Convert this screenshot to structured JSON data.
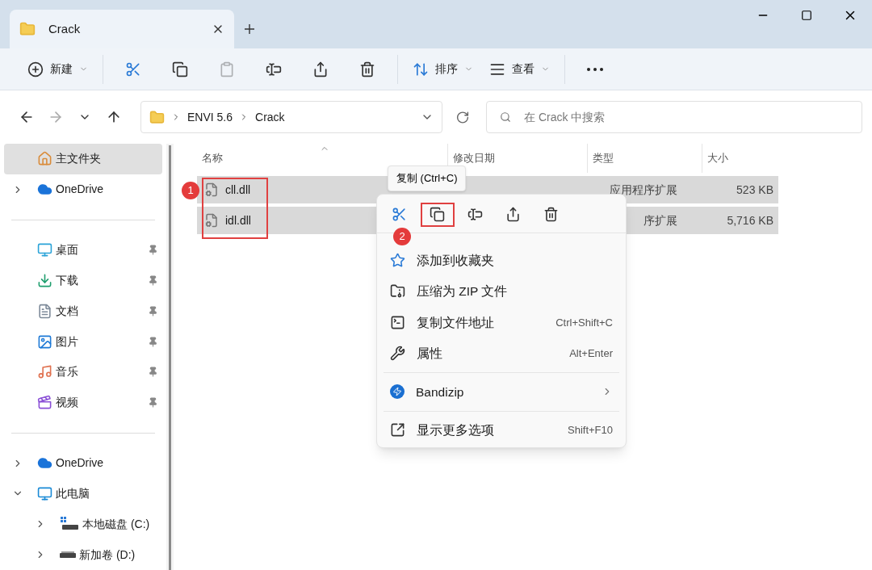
{
  "tabs": [
    {
      "label": "Crack",
      "selected": true
    }
  ],
  "toolbar": [
    {
      "kind": "new",
      "label": "新建",
      "disabled": false
    },
    {
      "kind": "cut",
      "disabled": false
    },
    {
      "kind": "copy",
      "disabled": false
    },
    {
      "kind": "paste",
      "disabled": true
    },
    {
      "kind": "rename",
      "disabled": false
    },
    {
      "kind": "share",
      "disabled": false
    },
    {
      "kind": "delete",
      "disabled": false
    },
    {
      "kind": "sort",
      "label": "排序",
      "disabled": false
    },
    {
      "kind": "view",
      "label": "查看",
      "disabled": false
    },
    {
      "kind": "more",
      "disabled": false
    }
  ],
  "breadcrumb": [
    "ENVI 5.6",
    "Crack"
  ],
  "search": {
    "placeholder": "在 Crack 中搜索"
  },
  "sidebar": {
    "sections": [
      [
        {
          "kind": "home",
          "label": "主文件夹",
          "selected": true
        },
        {
          "kind": "cloud",
          "label": "OneDrive",
          "selected": false,
          "expanded": false
        }
      ],
      [
        {
          "kind": "desktop",
          "label": "桌面",
          "selected": false,
          "pinned": true
        },
        {
          "kind": "download",
          "label": "下载",
          "selected": false,
          "pinned": true
        },
        {
          "kind": "docs",
          "label": "文档",
          "selected": false,
          "pinned": true
        },
        {
          "kind": "pictures",
          "label": "图片",
          "selected": false,
          "pinned": true
        },
        {
          "kind": "music",
          "label": "音乐",
          "selected": false,
          "pinned": true
        },
        {
          "kind": "video",
          "label": "视频",
          "selected": false,
          "pinned": true
        }
      ],
      [
        {
          "kind": "cloud",
          "label": "OneDrive",
          "selected": false,
          "expanded": false
        },
        {
          "kind": "pc",
          "label": "此电脑",
          "selected": false,
          "expanded": true,
          "children": [
            {
              "kind": "drive-c",
              "label": "本地磁盘 (C:)",
              "selected": false,
              "expanded": false
            },
            {
              "kind": "drive",
              "label": "新加卷 (D:)",
              "selected": false,
              "expanded": false
            }
          ]
        }
      ]
    ]
  },
  "table": {
    "columns": [
      "名称",
      "修改日期",
      "类型",
      "大小"
    ],
    "rows": [
      {
        "name": "cll.dll",
        "selected": true,
        "type": "应用程序扩展",
        "size": "523 KB"
      },
      {
        "name": "idl.dll",
        "selected": true,
        "type": "序扩展",
        "size": "5,716 KB"
      }
    ]
  },
  "context_menu": {
    "tooltip": "复制 (Ctrl+C)",
    "actions": [
      {
        "kind": "cut",
        "annotated": false
      },
      {
        "kind": "copy",
        "annotated": true
      },
      {
        "kind": "rename",
        "annotated": false
      },
      {
        "kind": "share",
        "annotated": false
      },
      {
        "kind": "delete",
        "annotated": false
      }
    ],
    "items": [
      {
        "kind": "star",
        "label": "添加到收藏夹",
        "divider_before": false
      },
      {
        "kind": "zip",
        "label": "压缩为 ZIP 文件",
        "divider_before": false
      },
      {
        "kind": "path",
        "label": "复制文件地址",
        "shortcut": "Ctrl+Shift+C",
        "divider_before": false
      },
      {
        "kind": "wrench",
        "label": "属性",
        "shortcut": "Alt+Enter",
        "divider_before": false
      },
      {
        "kind": "bandizip",
        "label": "Bandizip",
        "submenu": true,
        "divider_before": true
      },
      {
        "kind": "more",
        "label": "显示更多选项",
        "shortcut": "Shift+F10",
        "divider_before": true
      }
    ]
  },
  "annotations": [
    {
      "label": "1"
    },
    {
      "label": "2"
    }
  ]
}
